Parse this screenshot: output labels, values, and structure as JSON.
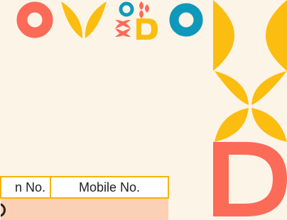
{
  "table": {
    "headers": [
      "n No.",
      "Mobile No."
    ]
  },
  "colors": {
    "background": "#fdf4e8",
    "coral": "#fc6a58",
    "yellow": "#fbbd0f",
    "teal": "#0e99ba",
    "peach_row": "#fbd0b5",
    "border": "#f5b400"
  }
}
